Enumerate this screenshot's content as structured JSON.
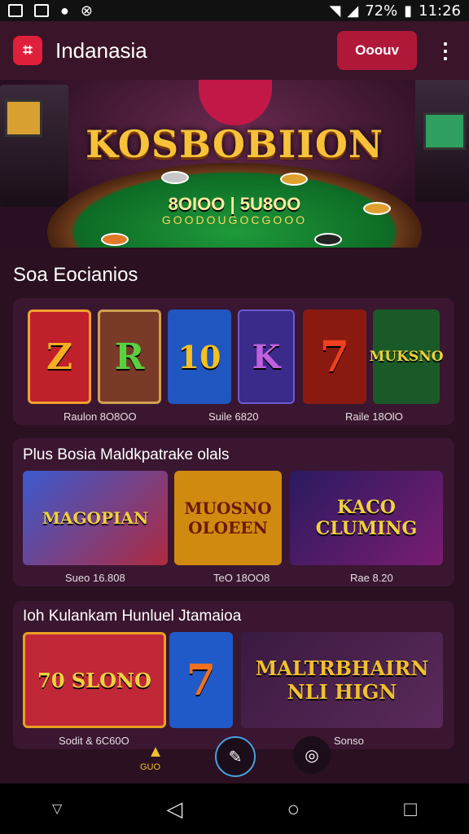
{
  "status": {
    "time": "11:26",
    "battery": "72%"
  },
  "appbar": {
    "title": "Indanasia",
    "cta_label": "Ooouv",
    "logo_glyph": "⌗"
  },
  "hero": {
    "title": "KOSBOBIION",
    "subtitle": "8OIOO | 5U8OO",
    "tagline": "GOODOUGOCGOOO"
  },
  "section1": {
    "title": "Soa Eocianios"
  },
  "row1": {
    "tiles": [
      {
        "label": "Z",
        "color": "#c0202a"
      },
      {
        "label": "R",
        "color": "#7a3a28"
      },
      {
        "label": "10",
        "color": "#1f56c0"
      },
      {
        "label": "K",
        "color": "#3a2a8a"
      },
      {
        "label": "7",
        "color": "#8a1a10"
      },
      {
        "label": "MUKSNO",
        "color": "#1a5a28"
      }
    ],
    "captions": [
      "Raulon 8O8OO",
      "Suile 6820",
      "Raile 18OlO"
    ]
  },
  "section2": {
    "title": "Plus Bosia Maldkpatrake olals",
    "tiles": [
      {
        "label": "MAGOPIAN",
        "color": "#b02a40"
      },
      {
        "label": "MUOSNO OLOEEN",
        "color": "#d08a10"
      },
      {
        "label": "KACO CLUMING",
        "color": "#7a1c70"
      }
    ],
    "captions": [
      "Sueo 16.808",
      "TeO 18OO8",
      "Rae 8.20"
    ]
  },
  "section3": {
    "title": "Ioh Kulankam Hunluel Jtamaioa",
    "tiles": [
      {
        "label": "70 SLONO",
        "color": "#c02838"
      },
      {
        "label": "7",
        "color": "#1f5ac8"
      },
      {
        "label": "MALTRBHAIRN NLI HIGN",
        "color": "#5a2a5a"
      }
    ],
    "captions": [
      "Sodit & 6C60O",
      "Sonso"
    ]
  },
  "bottom_fab": {
    "left_label": "GUO"
  },
  "nav": {
    "back": "◁",
    "home": "○",
    "recents": "□",
    "down": "▽"
  }
}
